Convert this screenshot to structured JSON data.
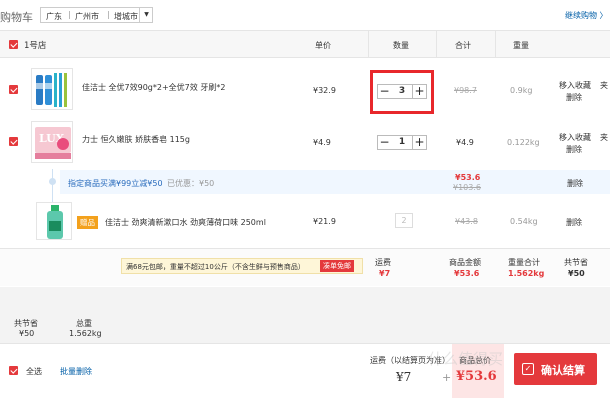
{
  "header": {
    "title": "购物车",
    "address": [
      "广东",
      "广州市",
      "增城市"
    ],
    "continue_label": "继续购物 〉"
  },
  "table_headers": {
    "shop": "1号店",
    "price": "单价",
    "qty": "数量",
    "total": "合计",
    "weight": "重量"
  },
  "items": [
    {
      "name": "佳洁士 全优7效90g*2+全优7效 牙刷*2",
      "price": "¥32.9",
      "qty": "3",
      "total": "¥98.7",
      "weight": "0.9kg",
      "action_move": "移入收藏",
      "action_move2": "夹",
      "action_delete": "删除"
    },
    {
      "name": "力士 恒久嫩肤 娇肤香皂 115g",
      "price": "¥4.9",
      "qty": "1",
      "total": "¥4.9",
      "weight": "0.122kg",
      "action_move": "移入收藏",
      "action_move2": "夹",
      "action_delete": "删除"
    }
  ],
  "promo": {
    "text": "指定商品买满¥99立减¥50",
    "discount_label": "已优惠：¥50",
    "price_new": "¥53.6",
    "price_old": "¥103.6",
    "delete": "删除"
  },
  "gift": {
    "tag": "赠品",
    "name": "佳洁士 劲爽清新漱口水 劲爽薄荷口味 250ml",
    "price": "¥21.9",
    "qty": "2",
    "total": "¥43.8",
    "weight": "0.54kg",
    "delete": "删除"
  },
  "shop_summary": {
    "notice": "满68元包邮，重量不超过10公斤（不含生鲜与预售商品）",
    "notice_button": "凑单免邮",
    "freight_label": "运费",
    "freight_value": "¥7",
    "amount_label": "商品金额",
    "amount_value": "¥53.6",
    "weight_label": "重量合计",
    "weight_value": "1.562kg",
    "saved_label": "共节省",
    "saved_value": "¥50"
  },
  "totals": {
    "saved_label": "共节省",
    "saved_value": "¥50",
    "weight_label": "总重",
    "weight_value": "1.562kg"
  },
  "footer": {
    "select_all": "全选",
    "batch_delete": "批量删除",
    "freight_label": "运费（以结算页为准）",
    "freight_value": "¥7",
    "plus": "+",
    "amount_label": "商品总价",
    "amount_value": "¥53.6",
    "checkout": "确认结算"
  },
  "watermark": "什么值得买"
}
